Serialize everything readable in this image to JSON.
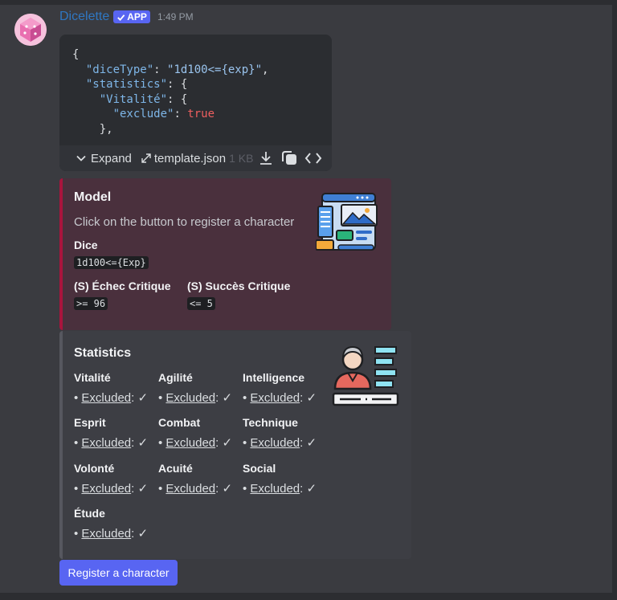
{
  "message": {
    "author": "Dicelette",
    "badge": "APP",
    "timestamp": "1:49 PM"
  },
  "attachment": {
    "code_lines": [
      "{",
      "  \"diceType\": \"1d100<={exp}\",",
      "  \"statistics\": {",
      "    \"Vitalité\": {",
      "      \"exclude\": true",
      "    },"
    ],
    "expand_label": "Expand",
    "filename": "template.json",
    "filesize": "1 KB",
    "icons": [
      "expand-arrows-icon",
      "download-icon",
      "copy-icon",
      "code-icon"
    ]
  },
  "model_embed": {
    "accent_color": "#a9143d",
    "title": "Model",
    "description": "Click on the button to register a character",
    "dice_label": "Dice",
    "dice_value": "1d100<={Exp}",
    "fail_label": "(S) Échec Critique",
    "fail_value": ">= 96",
    "success_label": "(S) Succès Critique",
    "success_value": "<= 5"
  },
  "stats_embed": {
    "title": "Statistics",
    "excluded_label": "Excluded",
    "check": "✓",
    "stats": [
      {
        "name": "Vitalité"
      },
      {
        "name": "Agilité"
      },
      {
        "name": "Intelligence"
      },
      {
        "name": "Esprit"
      },
      {
        "name": "Combat"
      },
      {
        "name": "Technique"
      },
      {
        "name": "Volonté"
      },
      {
        "name": "Acuité"
      },
      {
        "name": "Social"
      },
      {
        "name": "Étude"
      }
    ]
  },
  "register_button": "Register a character",
  "colors": {
    "background": "#3a3b40",
    "username": "#2f77c2",
    "button": "#5865f2"
  }
}
